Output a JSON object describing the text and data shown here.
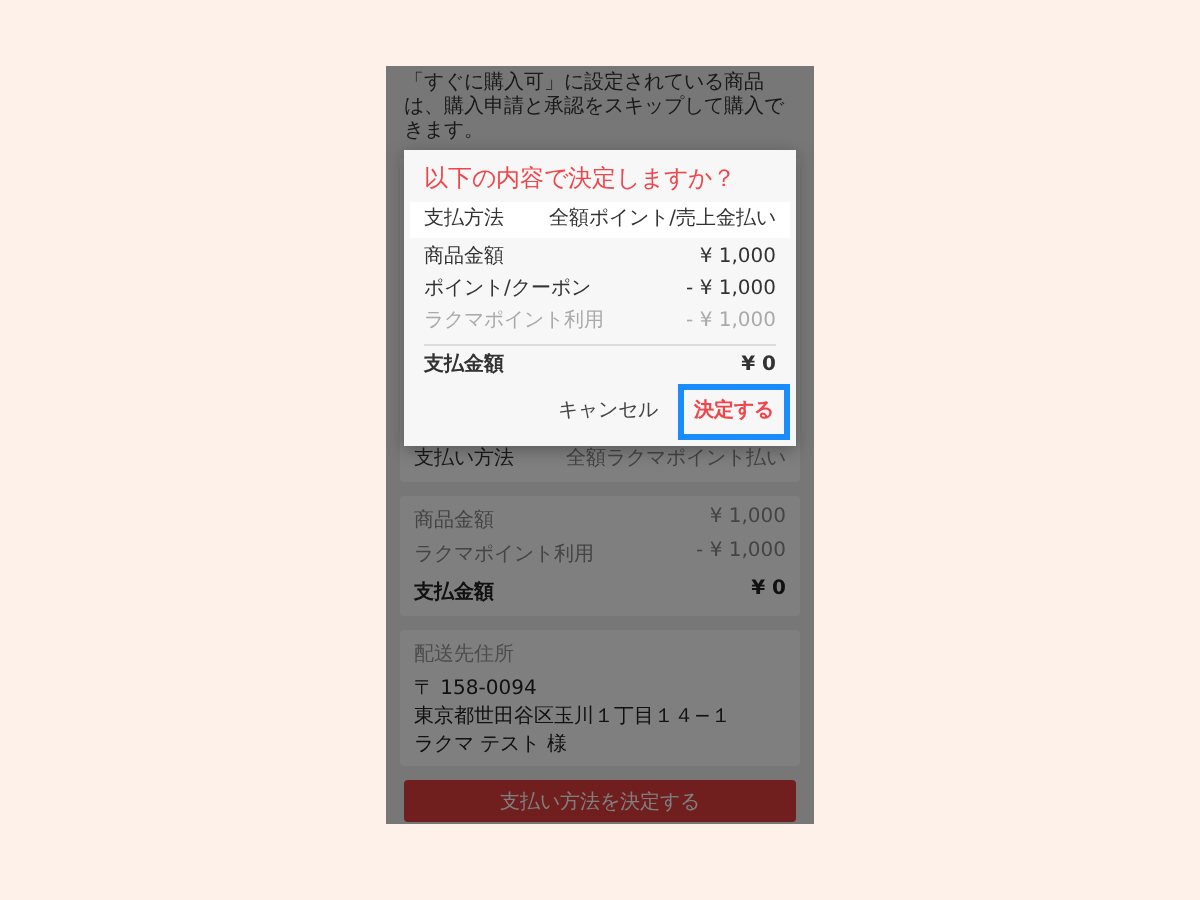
{
  "background_page": {
    "notice": "「すぐに購入可」に設定されている商品は、購入申請と承認をスキップして購入できます。",
    "payment_method": {
      "label": "支払い方法",
      "value": "全額ラクマポイント払い"
    },
    "summary": [
      {
        "label": "商品金額",
        "value": "¥ 1,000",
        "kind": "muted"
      },
      {
        "label": "ラクマポイント利用",
        "value": "- ¥ 1,000",
        "kind": "muted"
      },
      {
        "label": "支払金額",
        "value": "¥ 0",
        "kind": "total"
      }
    ],
    "shipping": {
      "heading": "配送先住所",
      "lines": [
        "〒 158-0094",
        "東京都世田谷区玉川１丁目１４−１",
        "ラクマ テスト 様"
      ]
    },
    "submit_button": "支払い方法を決定する"
  },
  "dialog": {
    "title": "以下の内容で決定しますか？",
    "rows": [
      {
        "label": "支払方法",
        "value": "全額ポイント/売上金払い",
        "kind": "highlight"
      },
      {
        "label": "商品金額",
        "value": "¥ 1,000",
        "kind": "normal"
      },
      {
        "label": "ポイント/クーポン",
        "value": "- ¥ 1,000",
        "kind": "normal"
      },
      {
        "label": "ラクマポイント利用",
        "value": "- ¥ 1,000",
        "kind": "sub"
      },
      {
        "label": "支払金額",
        "value": "¥ 0",
        "kind": "total"
      }
    ],
    "buttons": [
      {
        "label": "キャンセル",
        "kind": "cancel",
        "focused": false
      },
      {
        "label": "決定する",
        "kind": "confirm",
        "focused": true
      }
    ]
  }
}
